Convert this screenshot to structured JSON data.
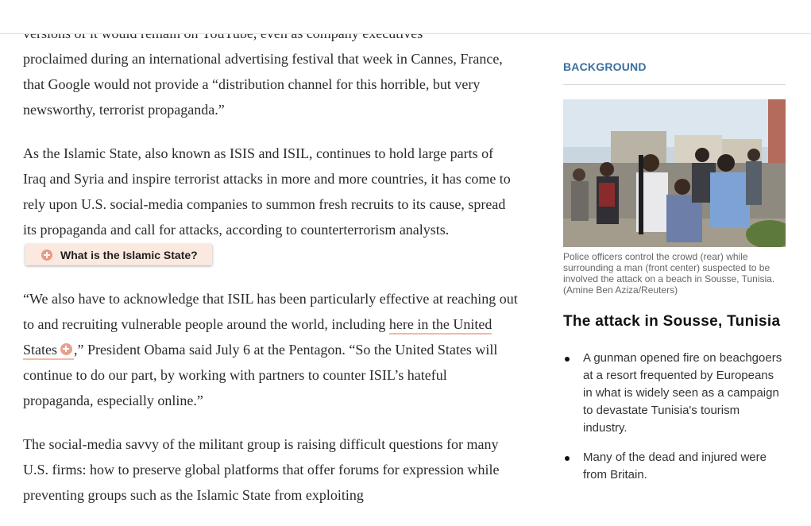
{
  "article": {
    "p1_clipped": "versions of it would remain on YouTube, even as company executives",
    "p1": "proclaimed during an international advertising festival that week in Cannes, France, that Google would not provide a “distribution channel for this horrible, but very newsworthy, terrorist propaganda.”",
    "p2": "As the Islamic State, also known as ISIS and ISIL, continues to hold large parts of Iraq and Syria and inspire terrorist attacks in more and more countries, it has come to rely upon U.S. social-media companies to summon fresh recruits to its cause, spread its propaganda and call for attacks, according to counterterrorism analysts.",
    "explainer_label": "What is the Islamic State?",
    "p3_start": "“We also have to acknowledge that ISIL has been particularly effective at reaching out to and recruiting vulnerable people around the world, including ",
    "p3_link": "here in the United States",
    "p3_end": ",” President Obama said July 6 at the Pentagon. “So the United States will continue to do our part, by working with partners to counter ISIL’s hateful propaganda, especially online.”",
    "p4": "The social-media savvy of the militant group is raising difficult questions for many U.S. firms: how to preserve global platforms that offer forums for expression while preventing groups such as the Islamic State from exploiting"
  },
  "sidebar": {
    "kicker": "BACKGROUND",
    "caption": "Police officers control the crowd (rear) while surrounding a man (front center) suspected to be involved the attack on a beach in Sousse, Tunisia. (Amine Ben Aziza/Reuters)",
    "headline": "The attack in Sousse, Tunisia",
    "bullets": [
      "A gunman opened fire on beachgoers at a resort frequented by Europeans in what is widely seen as a campaign to devastate Tunisia's tourism industry.",
      "Many of the dead and injured were from Britain."
    ]
  },
  "colors": {
    "kicker": "#3a6f9e",
    "explainer_bg": "#fbe9e0",
    "plus_icon": "#e89b85",
    "link_underline": "#f0b9a6"
  }
}
